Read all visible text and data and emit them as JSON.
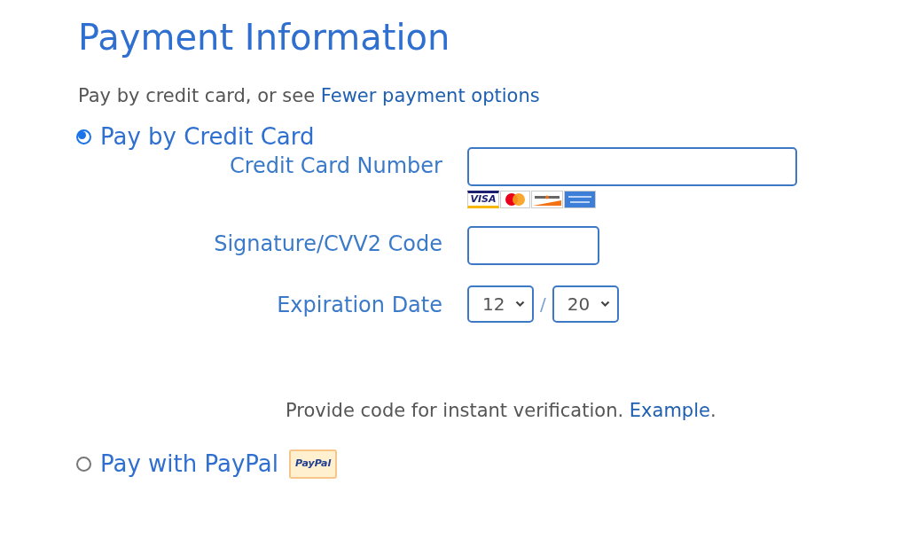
{
  "title": "Payment Information",
  "intro": {
    "text": "Pay by credit card, or see ",
    "link": "Fewer payment options"
  },
  "methods": [
    {
      "kind": "card",
      "label": "Pay by Credit Card",
      "selected": true
    },
    {
      "kind": "paypal",
      "label": "Pay with PayPal",
      "selected": false,
      "badge": "PayPal"
    }
  ],
  "card_form": {
    "number_label": "Credit Card Number",
    "card_logos": [
      {
        "kind": "visa",
        "text": "VISA"
      },
      {
        "kind": "mastercard"
      },
      {
        "kind": "discover"
      },
      {
        "kind": "amex"
      }
    ],
    "cvv_label": "Signature/CVV2 Code",
    "expiry_label": "Expiration Date",
    "month": "12",
    "separator": "/",
    "year": "20"
  },
  "verification": {
    "text": "Provide code for instant verification. ",
    "link": "Example",
    "after": "."
  }
}
